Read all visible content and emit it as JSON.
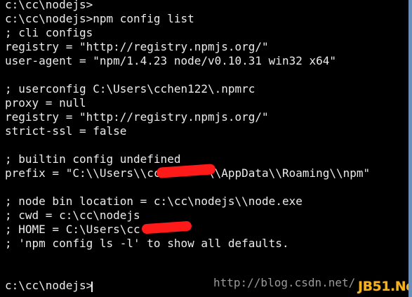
{
  "terminal": {
    "lines": [
      "c:\\cc\\nodejs>",
      "c:\\cc\\nodejs>npm config list",
      "; cli configs",
      "registry = \"http://registry.npmjs.org/\"",
      "user-agent = \"npm/1.4.23 node/v0.10.31 win32 x64\"",
      "",
      "; userconfig C:\\Users\\cchen122\\.npmrc",
      "proxy = null",
      "registry = \"http://registry.npmjs.org/\"",
      "strict-ssl = false",
      "",
      "; builtin config undefined",
      "prefix = \"C:\\\\Users\\\\cc       \\\\AppData\\\\Roaming\\\\npm\"",
      "",
      "; node bin location = c:\\cc\\nodejs\\\\node.exe",
      "; cwd = c:\\cc\\nodejs",
      "; HOME = C:\\Users\\cc",
      "; 'npm config ls -l' to show all defaults.",
      "",
      "",
      "c:\\cc\\nodejs>"
    ]
  },
  "watermark": {
    "text": "http://blog.csdn.net/"
  },
  "logo": {
    "text": "JB51.Net"
  },
  "colors": {
    "background": "#000000",
    "text": "#ececec",
    "redaction": "#ff1a1a",
    "watermark": "#9a9a9a",
    "logo": "#f6b21b",
    "frame": "#6b8fb8"
  }
}
